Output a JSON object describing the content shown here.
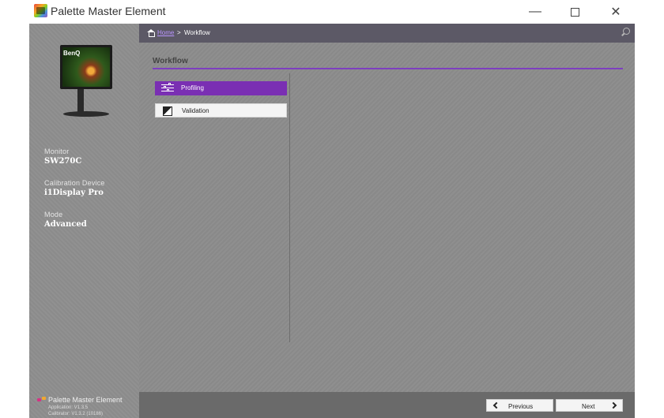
{
  "window": {
    "title": "Palette Master Element",
    "minimize_glyph": "—",
    "close_glyph": "✕"
  },
  "sidebar": {
    "monitor_brand": "BenQ",
    "info": [
      {
        "label": "Monitor",
        "value": "SW270C"
      },
      {
        "label": "Calibration Device",
        "value": "i1Display Pro"
      },
      {
        "label": "Mode",
        "value": "Advanced"
      }
    ],
    "footer": {
      "app_name": "Palette Master Element",
      "application_version": "Application: V1.3.5",
      "calibrator_version": "Calibrator: V1.3.2 (10186)"
    }
  },
  "breadcrumb": {
    "home": "Home",
    "separator": ">",
    "current": "Workflow"
  },
  "main": {
    "section_title": "Workflow",
    "workflow_items": [
      {
        "label": "Profiling",
        "icon": "sliders-icon",
        "selected": true
      },
      {
        "label": "Validation",
        "icon": "half-contrast-icon",
        "selected": false
      }
    ]
  },
  "nav": {
    "previous_label": "Previous",
    "next_label": "Next"
  },
  "colors": {
    "accent": "#7a2fb3",
    "breadcrumb_bar": "#5c5966",
    "link": "#b995ff",
    "panel_gray": "#8c8c8c"
  }
}
